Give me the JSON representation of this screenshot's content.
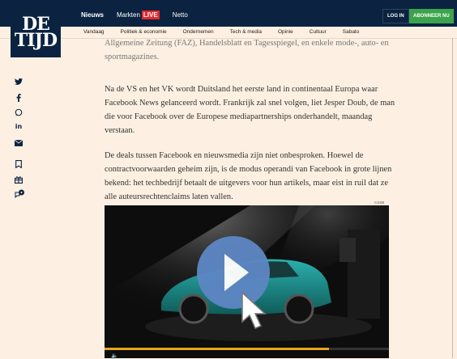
{
  "logo": {
    "line1": "DE",
    "line2": "TIJD"
  },
  "mainnav": {
    "nieuws": "Nieuws",
    "markten": "Markten",
    "live": "LIVE",
    "netto": "Netto"
  },
  "buttons": {
    "login": "LOG IN",
    "subscribe": "ABONNEER NU"
  },
  "subnav": [
    "Vandaag",
    "Politiek & economie",
    "Ondernemen",
    "Tech & media",
    "Opinie",
    "Cultuur",
    "Sabato"
  ],
  "article": {
    "p0": "Allgemeine Zeitung (FAZ), Handelsblatt en Tagesspiegel, en enkele mode-, auto- en sportmagazines.",
    "p1": "Na de VS en het VK wordt Duitsland het eerste land in continentaal Europa waar Facebook News gelanceerd wordt. Frankrijk zal snel volgen, liet Jesper Doub, de man die voor Facebook over de Europese mediapartnerships onderhandelt, maandag verstaan.",
    "p2": "De deals tussen Facebook en nieuwsmedia zijn niet onbesproken. Hoewel de contractvoorwaarden geheim zijn, is de modus operandi van Facebook in grote lijnen bekend: het techbedrijf betaalt de uitgevers voor hun artikels, maar eist in ruil dat ze alle auteursrechtenclaims laten vallen."
  },
  "video": {
    "label": "CSSB",
    "progress": 0.79
  },
  "share_icons": [
    "twitter-icon",
    "facebook-icon",
    "whatsapp-icon",
    "linkedin-icon",
    "mail-icon",
    "bookmark-icon",
    "gift-icon",
    "comments-icon"
  ],
  "colors": {
    "navy": "#0b2341",
    "live": "#e2282c",
    "subscribe": "#3ba34b",
    "play": "#5d86c3",
    "progress": "#e8a617",
    "background": "#fdf0e2"
  }
}
